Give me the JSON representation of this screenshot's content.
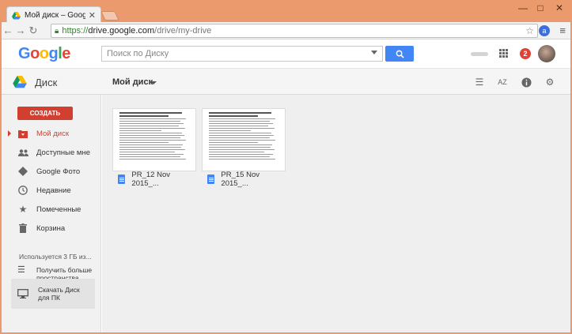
{
  "browser": {
    "tab_title": "Мой диск – Google Диск",
    "tab_close": "✕",
    "url_scheme": "https://",
    "url_host": "drive.google.com",
    "url_path": "/drive/my-drive",
    "window_min": "—",
    "window_max": "□",
    "window_close": "✕"
  },
  "header": {
    "logo": "Google",
    "search_placeholder": "Поиск по Диску",
    "notification_count": "2"
  },
  "drive_bar": {
    "product": "Диск",
    "current_folder": "Мой диск"
  },
  "sidebar": {
    "create_label": "СОЗДАТЬ",
    "items": [
      {
        "label": "Мой диск",
        "icon": "my-drive-icon",
        "active": true
      },
      {
        "label": "Доступные мне",
        "icon": "shared-people-icon"
      },
      {
        "label": "Google Фото",
        "icon": "photos-pinwheel-icon"
      },
      {
        "label": "Недавние",
        "icon": "clock-icon"
      },
      {
        "label": "Помеченные",
        "icon": "star-icon"
      },
      {
        "label": "Корзина",
        "icon": "trash-icon"
      }
    ],
    "storage_text": "Используется 3 ГБ из...",
    "more_space_line1": "Получить больше",
    "more_space_line2": "пространства",
    "download_line1": "Скачать Диск",
    "download_line2": "для ПК"
  },
  "files": [
    {
      "name": "PR_12 Nov 2015_..."
    },
    {
      "name": "PR_15 Nov 2015_..."
    }
  ],
  "colors": {
    "frame": "#ea9a6d",
    "create_button": "#d23f31",
    "search_button": "#4285f4",
    "notification": "#db4437"
  }
}
